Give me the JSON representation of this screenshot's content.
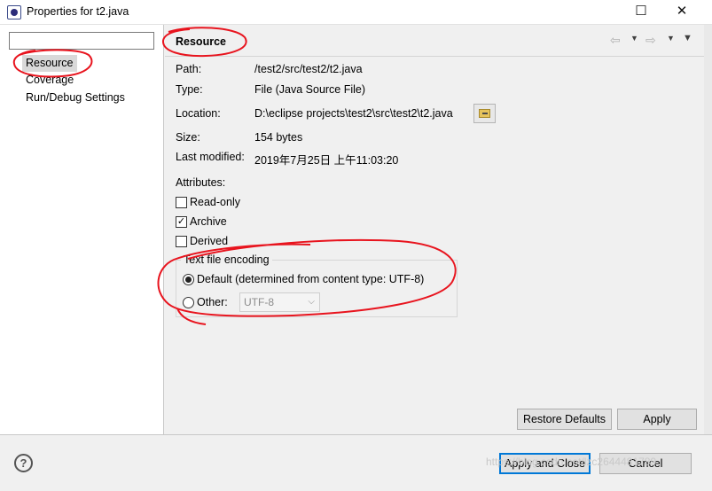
{
  "window": {
    "title": "Properties for t2.java",
    "close_symbol": "✕",
    "maximize_symbol": "☐"
  },
  "sidebar": {
    "filter_placeholder": "",
    "items": [
      {
        "label": "Resource",
        "selected": true
      },
      {
        "label": "Coverage",
        "selected": false
      },
      {
        "label": "Run/Debug Settings",
        "selected": false
      }
    ]
  },
  "page": {
    "title": "Resource",
    "nav_back_icon": "back-arrow-icon",
    "nav_forward_icon": "forward-arrow-icon",
    "menu_icon": "view-menu-icon"
  },
  "info": {
    "path_label": "Path:",
    "path_value": "/test2/src/test2/t2.java",
    "type_label": "Type:",
    "type_value": "File  (Java Source File)",
    "location_label": "Location:",
    "location_value": "D:\\eclipse projects\\test2\\src\\test2\\t2.java",
    "size_label": "Size:",
    "size_value": "154  bytes",
    "modified_label": "Last modified:",
    "modified_value": "2019年7月25日 上午11:03:20"
  },
  "attributes": {
    "heading": "Attributes:",
    "read_only": {
      "label": "Read-only",
      "checked": false
    },
    "archive": {
      "label": "Archive",
      "checked": true
    },
    "derived": {
      "label": "Derived",
      "checked": false
    }
  },
  "encoding": {
    "group_label": "Text file encoding",
    "default_option": "Default (determined from content type: UTF-8)",
    "other_option": "Other:",
    "other_value": "UTF-8",
    "selected": "default"
  },
  "buttons": {
    "restore_defaults": "Restore Defaults",
    "apply": "Apply",
    "apply_and_close": "Apply and Close",
    "cancel": "Cancel"
  },
  "help": {
    "symbol": "?"
  },
  "watermark": "https://blog.csdn.net/lzc2644481789",
  "colors": {
    "annotation_red": "#e8141e",
    "default_button_border": "#0078d7"
  }
}
